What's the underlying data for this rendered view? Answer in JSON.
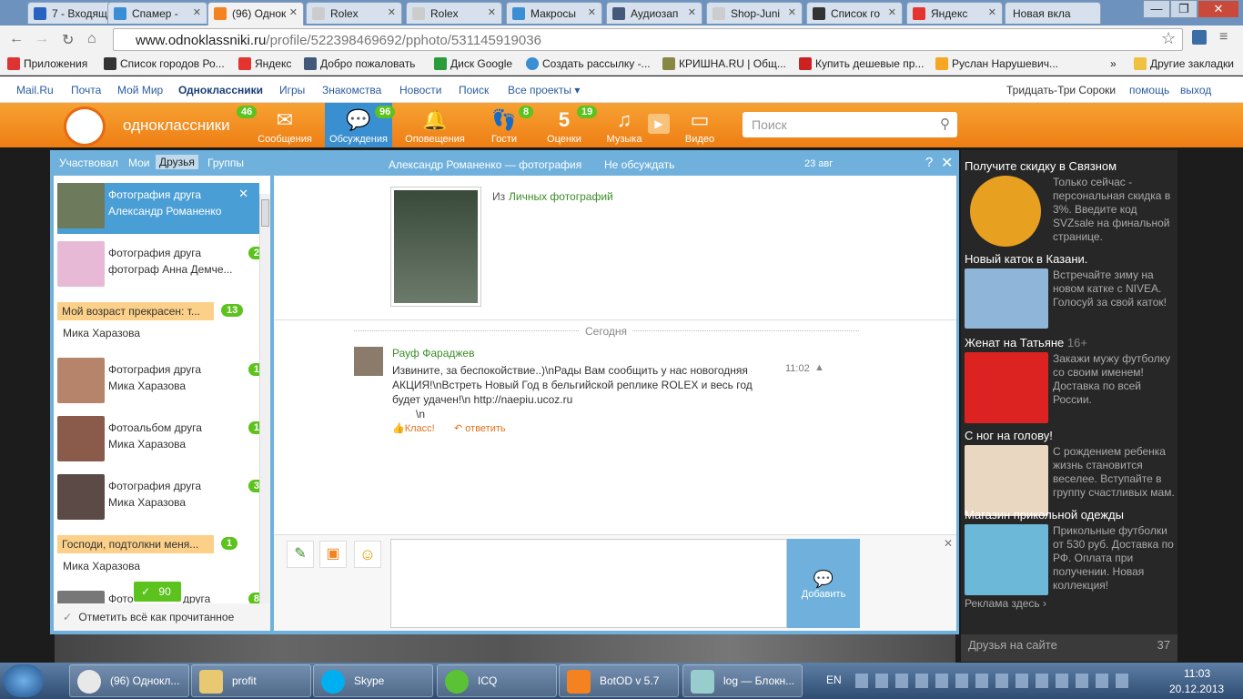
{
  "tabs": [
    {
      "title": "7 - Входящ",
      "color": "#2a62c2"
    },
    {
      "title": "Спамер -",
      "color": "#3a8ed3"
    },
    {
      "title": "(96) Однок",
      "color": "#f58220"
    },
    {
      "title": "Rolex",
      "color": "#cccccc"
    },
    {
      "title": "Rolex",
      "color": "#cccccc"
    },
    {
      "title": "Макросы",
      "color": "#3a8ed3"
    },
    {
      "title": "Аудиозап",
      "color": "#44587a"
    },
    {
      "title": "Shop-Juni",
      "color": "#cccccc"
    },
    {
      "title": "Список го",
      "color": "#333333"
    },
    {
      "title": "Яндекс",
      "color": "#e3342f"
    },
    {
      "title": "Новая вкла",
      "color": "#cccccc"
    }
  ],
  "window": {
    "minimize": "—",
    "maximize": "❐",
    "close": "✕"
  },
  "address": {
    "host": "www.odnoklassniki.ru",
    "path": "/profile/522398469692/pphoto/531145919036"
  },
  "bookmarks": [
    {
      "label": "Приложения",
      "color": "#d33"
    },
    {
      "label": "Список городов Ро...",
      "color": "#333"
    },
    {
      "label": "Яндекс",
      "color": "#e3342f"
    },
    {
      "label": "Добро пожаловать",
      "color": "#44587a"
    },
    {
      "label": "Диск Google",
      "color": "#2a9d3a"
    },
    {
      "label": "Создать рассылку -...",
      "color": "#3a8ed3"
    },
    {
      "label": "КРИШНА.RU | Общ...",
      "color": "#884"
    },
    {
      "label": "Купить дешевые пр...",
      "color": "#c22"
    },
    {
      "label": "Руслан Нарушевич...",
      "color": "#f5a623"
    },
    {
      "label": "»",
      "color": ""
    },
    {
      "label": "Другие закладки",
      "color": "#f0c040"
    }
  ],
  "mailbar": {
    "links": [
      "Mail.Ru",
      "Почта",
      "Мой Мир",
      "Одноклассники",
      "Игры",
      "Знакомства",
      "Новости",
      "Поиск",
      "Все проекты ▾"
    ],
    "user": "Тридцать-Три Сороки",
    "help": "помощь",
    "logout": "выход"
  },
  "ok": {
    "logo": "одноклассники",
    "logo_badge": "46",
    "nav": [
      {
        "label": "Сообщения",
        "icon": "✉",
        "badge": ""
      },
      {
        "label": "Обсуждения",
        "icon": "💬",
        "badge": "96"
      },
      {
        "label": "Оповещения",
        "icon": "🔔",
        "badge": ""
      },
      {
        "label": "Гости",
        "icon": "👣",
        "badge": "8"
      },
      {
        "label": "Оценки",
        "icon": "5",
        "badge": "19"
      },
      {
        "label": "Музыка",
        "icon": "♫",
        "badge": ""
      },
      {
        "label": "Видео",
        "icon": "▶",
        "badge": ""
      }
    ],
    "search_placeholder": "Поиск"
  },
  "left": {
    "tabs": [
      "Участвовал",
      "Мои",
      "Друзья",
      "Группы"
    ],
    "items": [
      {
        "t1": "Фотография друга",
        "t2": "Александр Романенко",
        "badge": ""
      },
      {
        "t1": "Фотография друга",
        "t2": "фотограф Анна Демче...",
        "badge": "2"
      },
      {
        "bubble": "Мой возраст прекрасен: т...",
        "name": "Мика Харазова",
        "badge": "13"
      },
      {
        "t1": "Фотография друга",
        "t2": "Мика Харазова",
        "badge": "1"
      },
      {
        "t1": "Фотоальбом друга",
        "t2": "Мика Харазова",
        "badge": "1"
      },
      {
        "t1": "Фотография друга",
        "t2": "Мика Харазова",
        "badge": "3"
      },
      {
        "bubble": "Господи, подтолкни меня...",
        "name": "Мика Харазова",
        "badge": "1"
      },
      {
        "t1": "Фото",
        "t2": "",
        "badge": "8",
        "tail": "друга"
      }
    ],
    "counter": "90",
    "markall": "Отметить всё как прочитанное"
  },
  "center": {
    "title": "Александр Романенко — фотография",
    "nodiscuss": "Не обсуждать",
    "date": "23 авг",
    "help": "?",
    "close": "✕",
    "from_prefix": "Из",
    "from_link": "Личных фотографий",
    "today": "Сегодня",
    "author": "Рауф Фараджев",
    "text1": "Извините, за беспокойствие..)\\nРады Вам сообщить у нас новогодняя",
    "text2": "АКЦИЯ!\\nВстреть Новый Год в бельгийской реплике ROLEX и весь год",
    "text3": "будет удачен!\\n http://naepiu.ucoz.ru",
    "text4": "\\n",
    "time": "11:02",
    "klass": "Класс!",
    "reply": "ответить",
    "add": "Добавить"
  },
  "ads": [
    {
      "h": "Получите скидку в Связном",
      "d": "Только сейчас - персональная скидка в 3%. Введите код SVZsale на финальной странице.",
      "color": "#e8a020"
    },
    {
      "h": "Новый каток в Казани.",
      "d": "Встречайте зиму на новом катке с NIVEA. Голосуй за свой каток!",
      "color": "#8fb6d8"
    },
    {
      "h": "Женат на Татьяне",
      "h2": "16+",
      "d": "Закажи мужу футболку со своим именем! Доставка по всей России.",
      "color": "#d22"
    },
    {
      "h": "С ног на голову!",
      "d": "С рождением ребенка жизнь становится веселее. Вступайте в группу счастливых мам.",
      "color": "#e9d7c2"
    },
    {
      "h": "Магазин прикольной одежды",
      "d": "Прикольные футболки от 530 руб. Доставка по РФ. Оплата при получении. Новая коллекция!",
      "color": "#6bb8d8"
    }
  ],
  "ads_more": "Реклама здесь ›",
  "friends": {
    "label": "Друзья на сайте",
    "count": "37"
  },
  "taskbar": [
    {
      "label": "(96) Однокл...",
      "color": "#e8e8e8"
    },
    {
      "label": "profit",
      "color": "#e8c870"
    },
    {
      "label": "Skype",
      "color": "#00aff0"
    },
    {
      "label": "ICQ",
      "color": "#5bc236"
    },
    {
      "label": "BotOD  v 5.7",
      "color": "#f58220"
    },
    {
      "label": "log — Блокн...",
      "color": "#9cc"
    }
  ],
  "tray": {
    "lang": "EN",
    "time": "11:03",
    "date": "20.12.2013"
  }
}
